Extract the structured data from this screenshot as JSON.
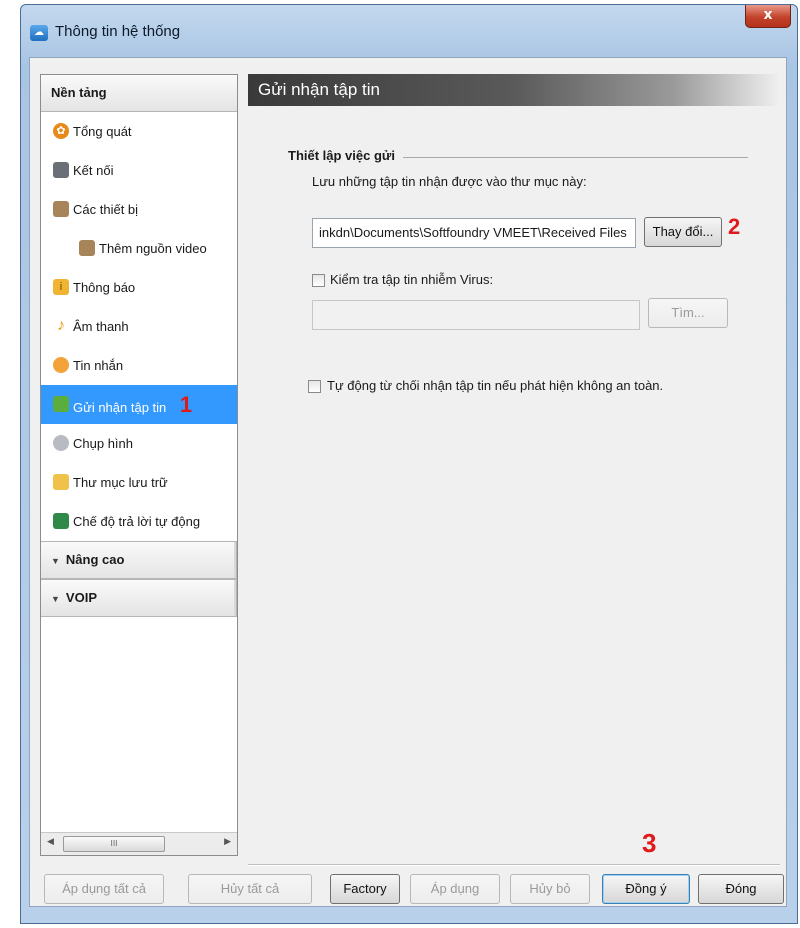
{
  "window": {
    "title": "Thông tin hệ thống",
    "close_label": "x"
  },
  "sidebar": {
    "header": "Nền tảng",
    "items": [
      {
        "label": "Tổng quát",
        "icon": "gear-icon"
      },
      {
        "label": "Kết nối",
        "icon": "computer-icon"
      },
      {
        "label": "Các thiết bị",
        "icon": "devices-icon"
      },
      {
        "label": "Thêm nguồn video",
        "icon": "video-source-icon"
      },
      {
        "label": "Thông báo",
        "icon": "notification-icon"
      },
      {
        "label": "Âm thanh",
        "icon": "music-note-icon"
      },
      {
        "label": "Tin nhắn",
        "icon": "message-icon"
      },
      {
        "label": "Gửi nhận tập tin",
        "icon": "file-transfer-icon"
      },
      {
        "label": "Chụp hình",
        "icon": "camera-icon"
      },
      {
        "label": "Thư mục lưu trữ",
        "icon": "folder-icon"
      },
      {
        "label": "Chế độ trả lời tự động",
        "icon": "auto-answer-icon"
      }
    ],
    "groups": [
      "Nâng cao",
      "VOIP"
    ],
    "scroll_thumb": "III"
  },
  "annotations": {
    "one": "1",
    "two": "2",
    "three": "3"
  },
  "panel": {
    "header": "Gửi nhận tập tin",
    "section_title": "Thiết lập việc gửi",
    "save_label": "Lưu những tập tin nhận được vào thư mục này:",
    "save_path": "inkdn\\Documents\\Softfoundry VMEET\\Received Files",
    "change_button": "Thay đổi...",
    "virus_check_label": "Kiểm tra tập tin nhiễm Virus:",
    "virus_path": "",
    "find_button": "Tìm...",
    "auto_reject_label": "Tự động từ chối nhận tập tin nếu phát hiện không an toàn."
  },
  "buttons": {
    "apply_all": "Áp dụng tất cả",
    "cancel_all": "Hủy tất cả",
    "factory": "Factory",
    "apply": "Áp dụng",
    "cancel": "Hủy bỏ",
    "ok": "Đồng ý",
    "close": "Đóng"
  },
  "colors": {
    "selection": "#3399ff",
    "annotation_red": "#e01a1a"
  }
}
